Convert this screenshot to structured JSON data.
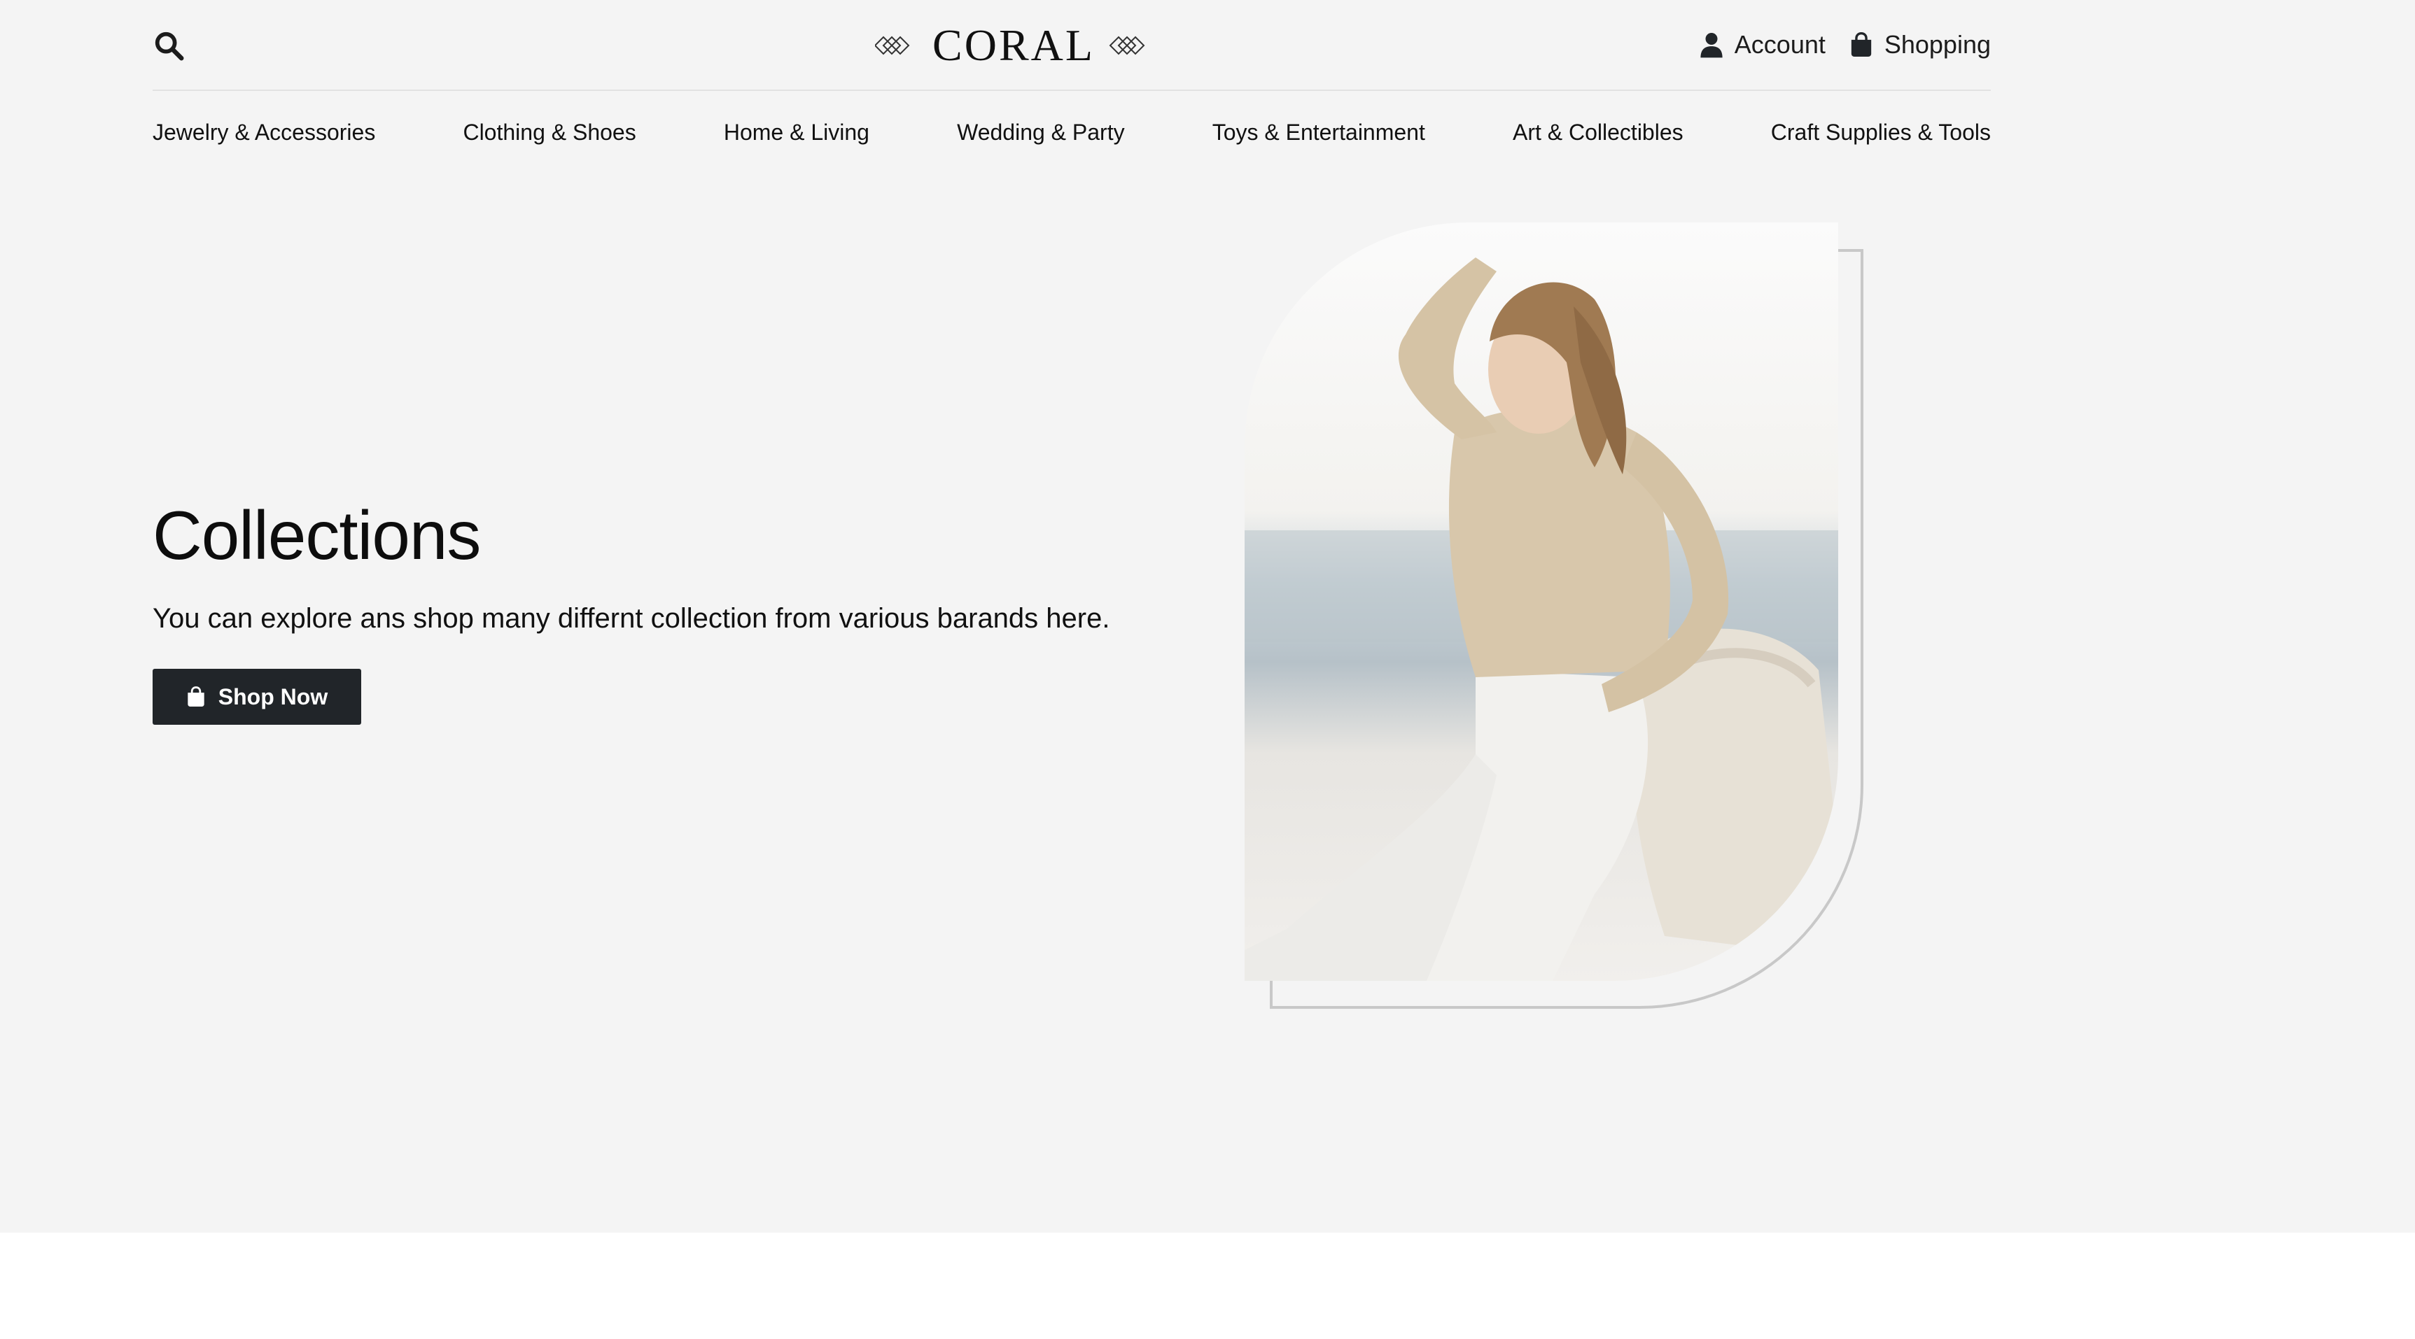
{
  "header": {
    "logo_text": "CORAL",
    "account_label": "Account",
    "shopping_label": "Shopping"
  },
  "nav": {
    "items": [
      {
        "label": "Jewelry & Accessories"
      },
      {
        "label": "Clothing & Shoes"
      },
      {
        "label": "Home & Living"
      },
      {
        "label": "Wedding & Party"
      },
      {
        "label": "Toys & Entertainment"
      },
      {
        "label": "Art & Collectibles"
      },
      {
        "label": "Craft Supplies & Tools"
      }
    ]
  },
  "hero": {
    "title": "Collections",
    "subtitle": "You can explore ans shop many differnt collection from various barands here.",
    "button_label": "Shop Now"
  },
  "icons": {
    "search": "search-icon",
    "account": "user-icon",
    "shopping": "shopping-bag-icon",
    "logo_ornament": "diamond-ornament-icon"
  },
  "colors": {
    "page_background": "#f4f4f4",
    "button_background": "#212529",
    "button_text": "#ffffff",
    "text": "#111111",
    "frame_outline": "#c8c8c8"
  }
}
